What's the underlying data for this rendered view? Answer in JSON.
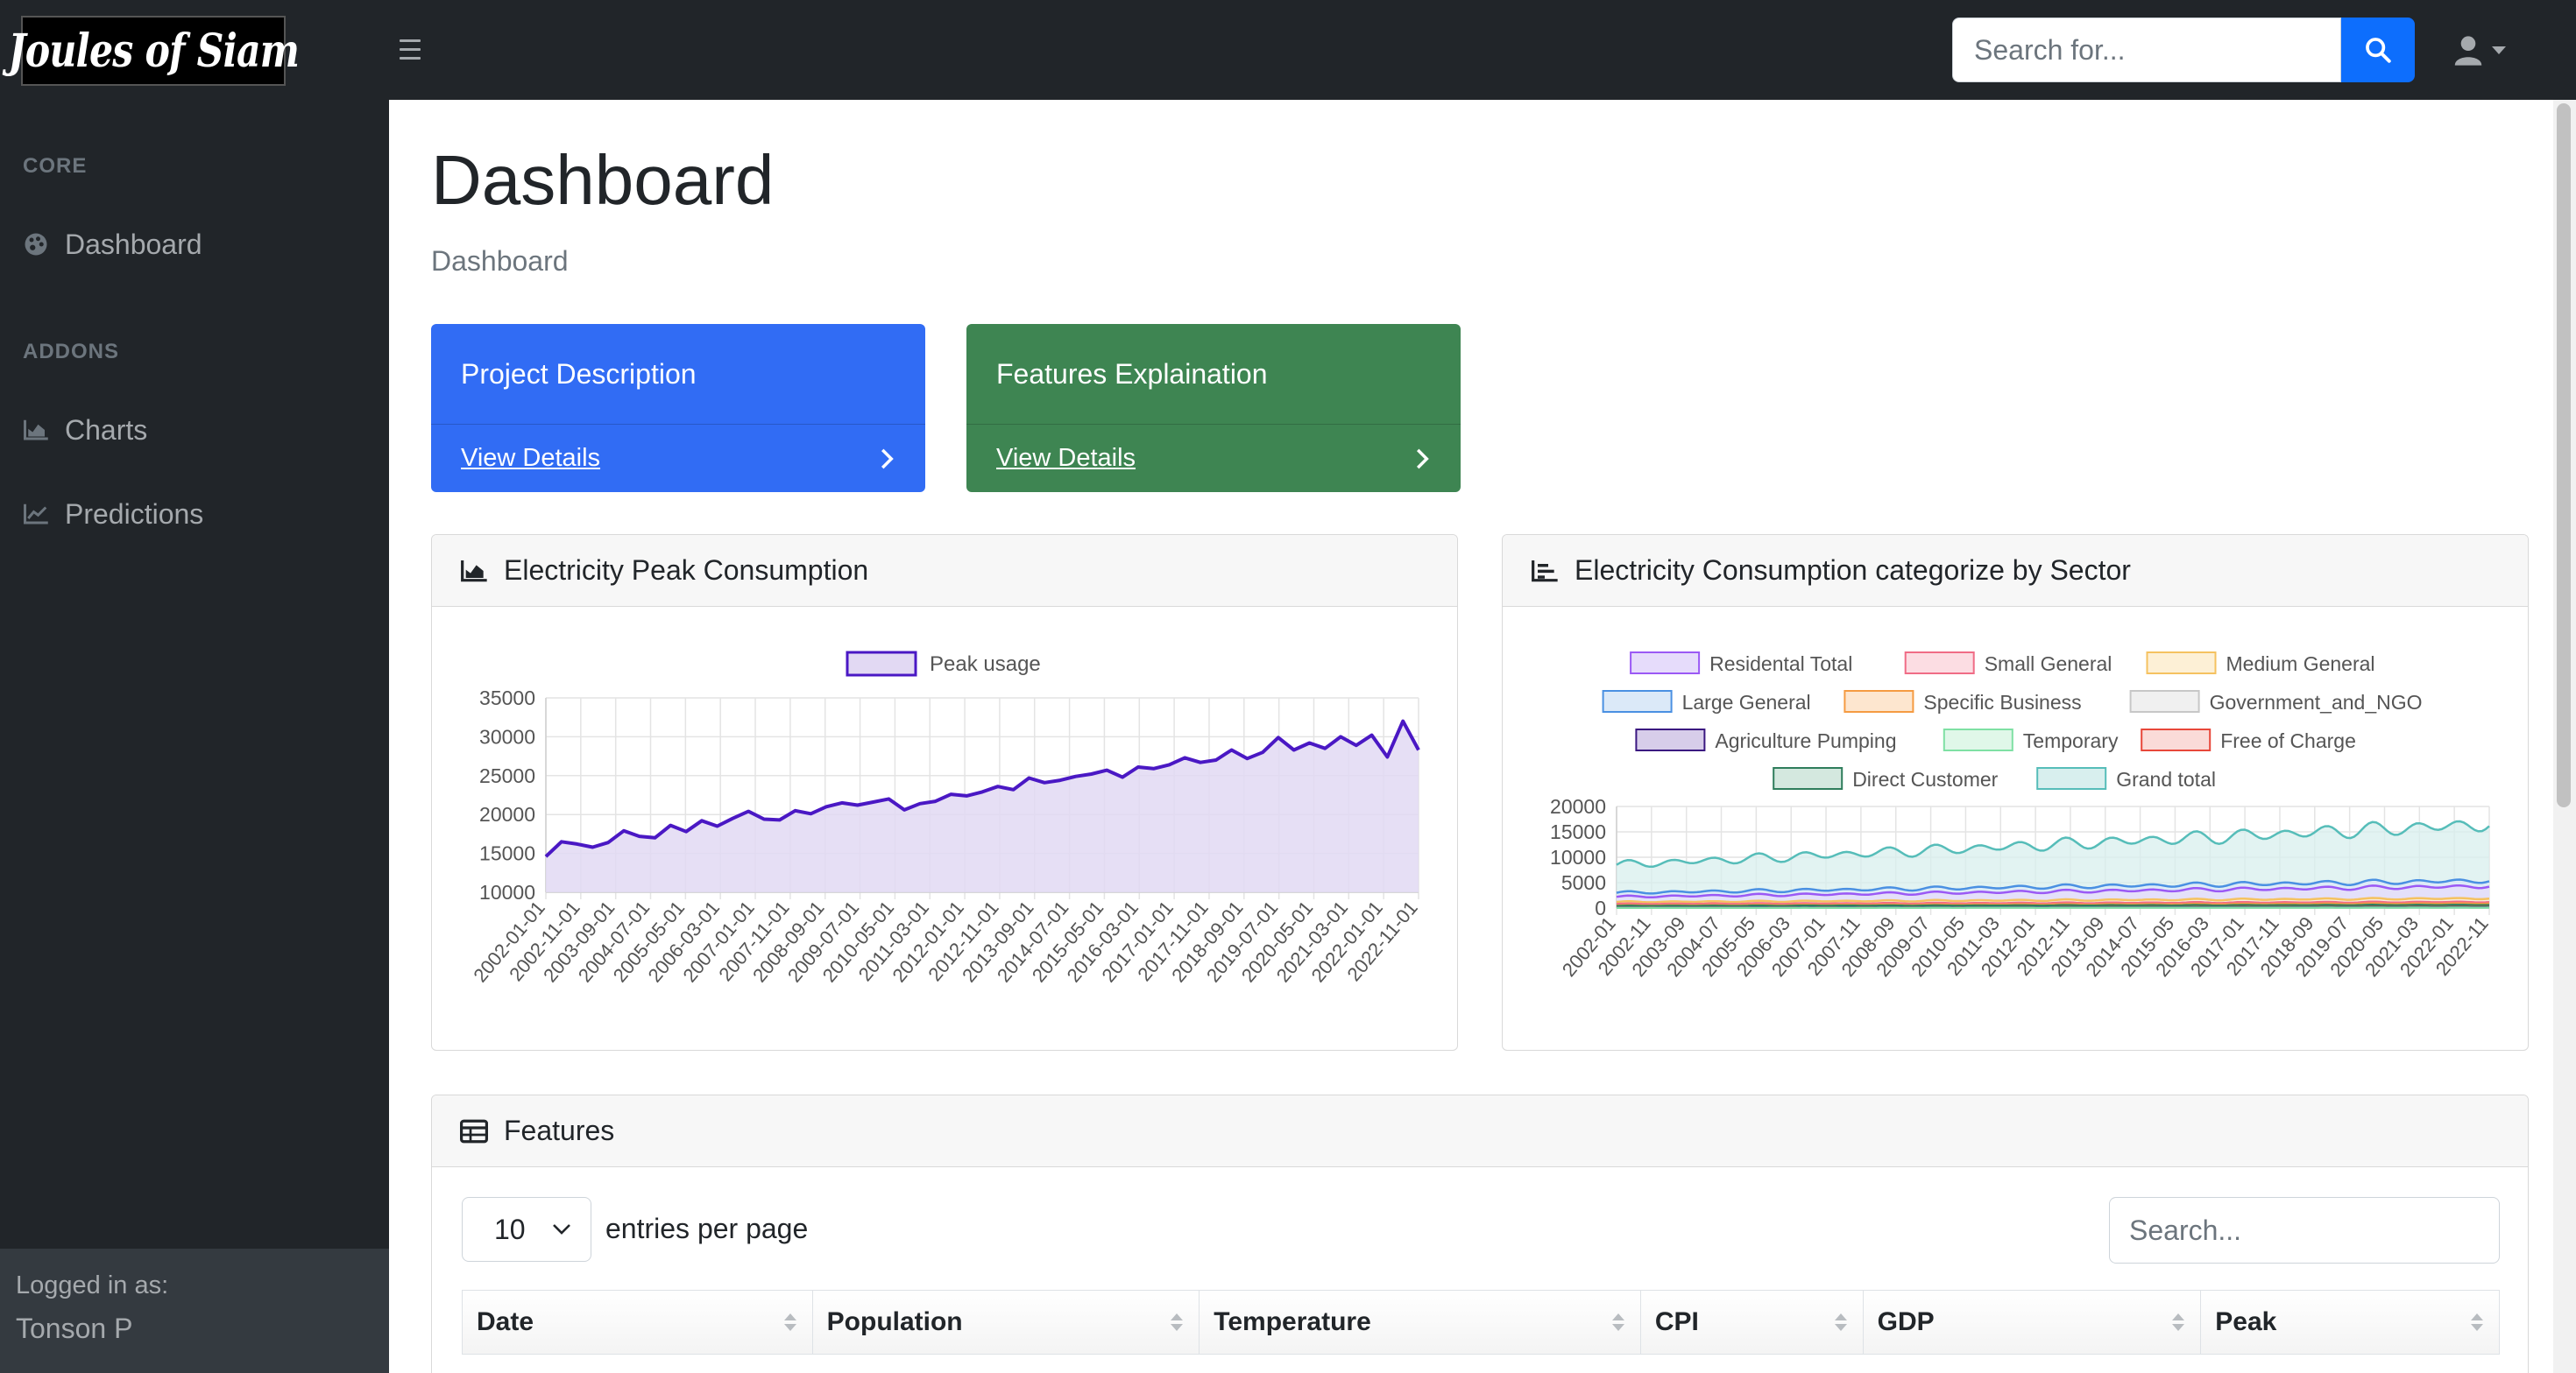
{
  "brand": {
    "logo_text": "Joules of Siam"
  },
  "topbar": {
    "search_placeholder": "Search for..."
  },
  "sidebar": {
    "core_heading": "CORE",
    "addons_heading": "ADDONS",
    "items": [
      {
        "label": "Dashboard",
        "icon": "palette-icon"
      },
      {
        "label": "Charts",
        "icon": "area-chart-icon"
      },
      {
        "label": "Predictions",
        "icon": "line-chart-icon"
      }
    ],
    "footer_small": "Logged in as:",
    "footer_name": "Tonson P"
  },
  "page": {
    "title": "Dashboard",
    "breadcrumb": "Dashboard"
  },
  "cards": [
    {
      "title": "Project Description",
      "link": "View Details",
      "color": "#316cf4"
    },
    {
      "title": "Features Explaination",
      "link": "View Details",
      "color": "#3e8552"
    }
  ],
  "chart_panels": [
    {
      "title": "Electricity Peak Consumption",
      "icon": "area-chart-icon"
    },
    {
      "title": "Electricity Consumption categorize by Sector",
      "icon": "bar-chart-icon"
    }
  ],
  "features": {
    "title": "Features",
    "entries_value": "10",
    "entries_label": "entries per page",
    "search_placeholder": "Search...",
    "columns": [
      "Date",
      "Population",
      "Temperature",
      "CPI",
      "GDP",
      "Peak"
    ]
  },
  "chart_data": [
    {
      "type": "area",
      "title": "",
      "xlabel": "",
      "ylabel": "",
      "ylim": [
        10000,
        35000
      ],
      "y_ticks": [
        35000,
        30000,
        25000,
        20000,
        15000,
        10000
      ],
      "grid": true,
      "legend_position": "top",
      "x_tick_labels": [
        "2002-01-01",
        "2002-11-01",
        "2003-09-01",
        "2004-07-01",
        "2005-05-01",
        "2006-03-01",
        "2007-01-01",
        "2007-11-01",
        "2008-09-01",
        "2009-07-01",
        "2010-05-01",
        "2011-03-01",
        "2012-01-01",
        "2012-11-01",
        "2013-09-01",
        "2014-07-01",
        "2015-05-01",
        "2016-03-01",
        "2017-01-01",
        "2017-11-01",
        "2018-09-01",
        "2019-07-01",
        "2020-05-01",
        "2021-03-01",
        "2022-01-01",
        "2022-11-01"
      ],
      "series": [
        {
          "name": "Peak usage",
          "color": "#4a18c4",
          "fill": "#e2d9f3",
          "values": [
            14600,
            16500,
            16200,
            15800,
            16400,
            17900,
            17200,
            17000,
            18600,
            17800,
            19200,
            18500,
            19500,
            20400,
            19400,
            19300,
            20500,
            20100,
            21000,
            21500,
            21200,
            21600,
            22000,
            20600,
            21400,
            21700,
            22600,
            22400,
            22900,
            23600,
            23200,
            24700,
            24100,
            24400,
            24900,
            25200,
            25700,
            24800,
            26100,
            25900,
            26400,
            27300,
            26700,
            27000,
            28300,
            27200,
            28000,
            29900,
            28300,
            29200,
            28500,
            30000,
            28900,
            30200,
            27400,
            32000,
            28300
          ]
        }
      ]
    },
    {
      "type": "area",
      "title": "",
      "xlabel": "",
      "ylabel": "",
      "ylim": [
        0,
        20000
      ],
      "y_ticks": [
        20000,
        15000,
        10000,
        5000,
        0
      ],
      "grid": true,
      "legend_position": "top",
      "x_tick_labels": [
        "2002-01",
        "2002-11",
        "2003-09",
        "2004-07",
        "2005-05",
        "2006-03",
        "2007-01",
        "2007-11",
        "2008-09",
        "2009-07",
        "2010-05",
        "2011-03",
        "2012-01",
        "2012-11",
        "2013-09",
        "2014-07",
        "2015-05",
        "2016-03",
        "2017-01",
        "2017-11",
        "2018-09",
        "2019-07",
        "2020-05",
        "2021-03",
        "2022-01",
        "2022-11"
      ],
      "series": [
        {
          "name": "Residental Total",
          "color": "#9b59f5",
          "fill": "#e6dcfb",
          "start": 2200,
          "end": 4300
        },
        {
          "name": "Small General",
          "color": "#f06c86",
          "fill": "#fcdde3",
          "start": 800,
          "end": 1200
        },
        {
          "name": "Medium General",
          "color": "#f5c260",
          "fill": "#fdf0d6",
          "start": 1200,
          "end": 1900
        },
        {
          "name": "Large General",
          "color": "#4a90e2",
          "fill": "#dbe9f8",
          "start": 3000,
          "end": 5400
        },
        {
          "name": "Specific Business",
          "color": "#f59b42",
          "fill": "#fde6cf",
          "start": 500,
          "end": 900
        },
        {
          "name": "Government_and_NGO",
          "color": "#c7c7c7",
          "fill": "#f0f0f0",
          "start": 300,
          "end": 600
        },
        {
          "name": "Agriculture Pumping",
          "color": "#3a1780",
          "fill": "#d7cdea",
          "start": 100,
          "end": 150
        },
        {
          "name": "Temporary",
          "color": "#7fe0a4",
          "fill": "#e0f7e9",
          "start": 50,
          "end": 80
        },
        {
          "name": "Free of Charge",
          "color": "#e8473a",
          "fill": "#fadbd8",
          "start": 100,
          "end": 200
        },
        {
          "name": "Direct Customer",
          "color": "#2f7d5c",
          "fill": "#d4e8df",
          "start": 400,
          "end": 600
        },
        {
          "name": "Grand total",
          "color": "#56bdb9",
          "fill": "#d8efee",
          "start": 8500,
          "end": 16500
        }
      ]
    }
  ]
}
